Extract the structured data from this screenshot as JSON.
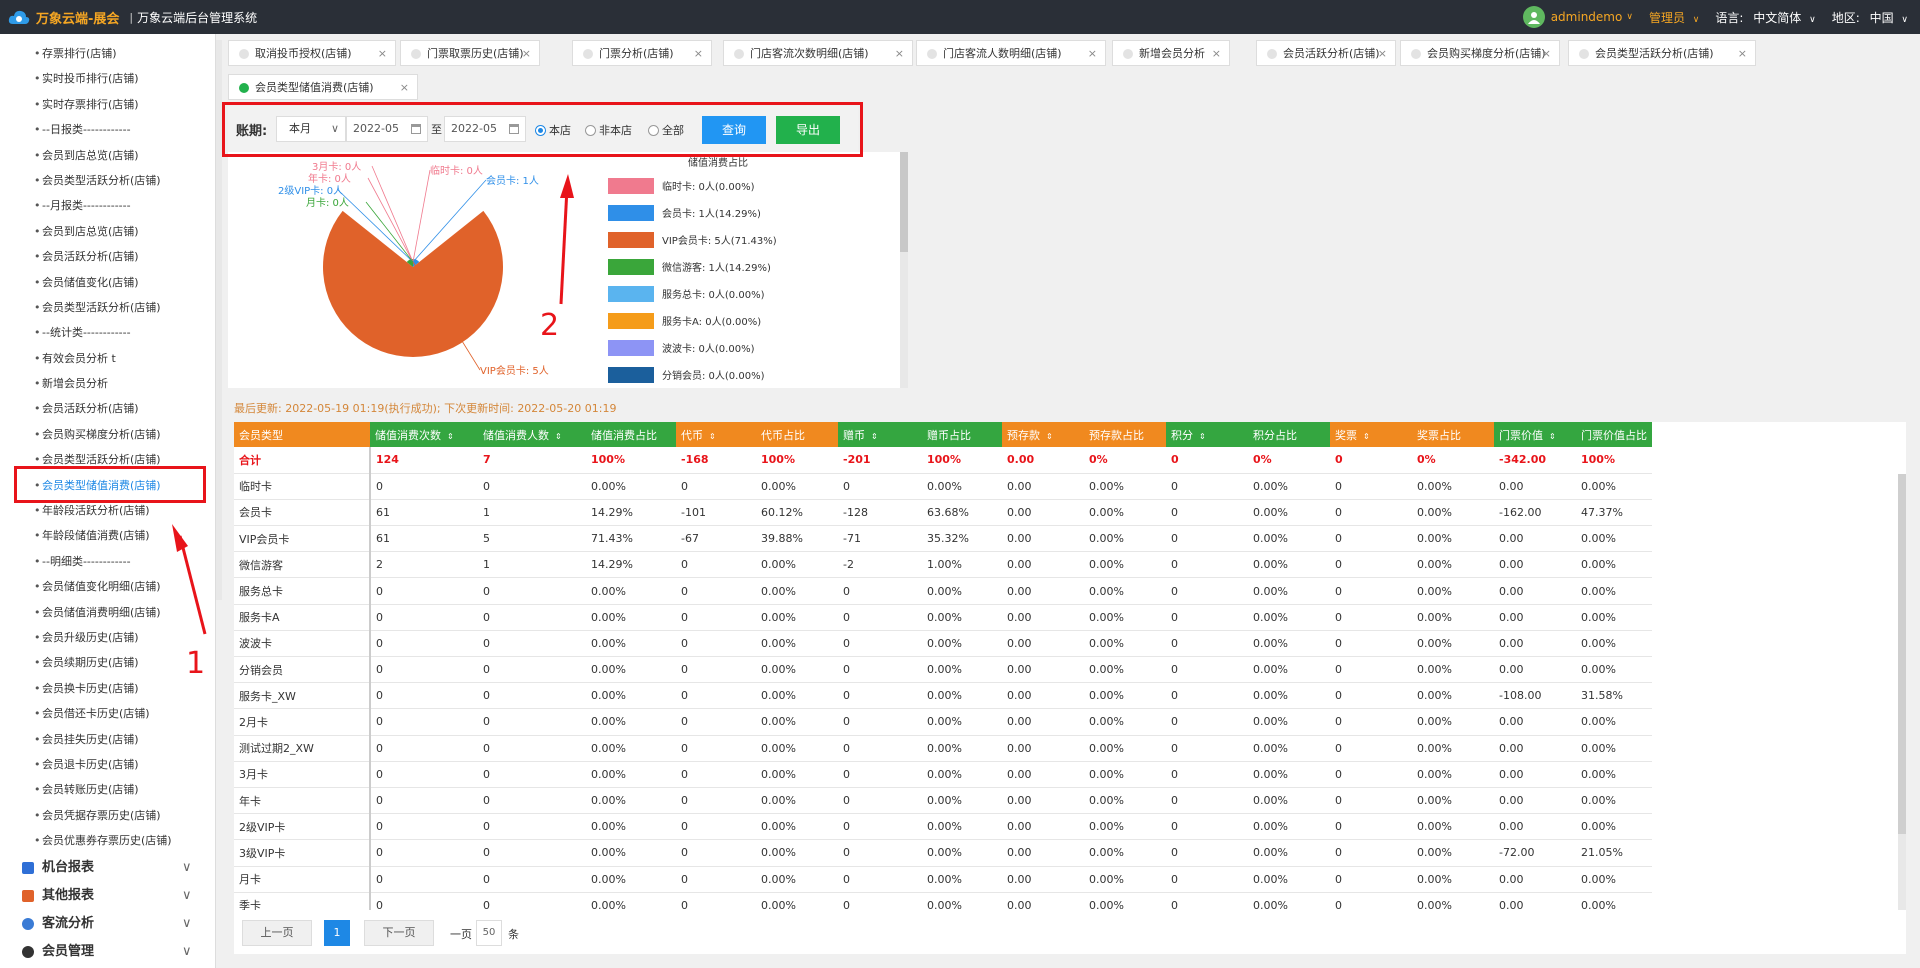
{
  "header": {
    "brand": "万象云端-展会",
    "separator": "|",
    "system_title": "万象云端后台管理系统",
    "username": "admindemo",
    "role": "管理员",
    "language_label": "语言:",
    "language_value": "中文简体",
    "region_label": "地区:",
    "region_value": "中国"
  },
  "sidebar": {
    "items": [
      "存票排行(店铺)",
      "实时投币排行(店铺)",
      "实时存票排行(店铺)",
      "--日报类------------",
      "会员到店总览(店铺)",
      "会员类型活跃分析(店铺)",
      "--月报类------------",
      "会员到店总览(店铺)",
      "会员活跃分析(店铺)",
      "会员储值变化(店铺)",
      "会员类型活跃分析(店铺)",
      "--统计类------------",
      "有效会员分析 t",
      "新增会员分析",
      "会员活跃分析(店铺)",
      "会员购买梯度分析(店铺)",
      "会员类型活跃分析(店铺)",
      "会员类型储值消费(店铺)",
      "年龄段活跃分析(店铺)",
      "年龄段储值消费(店铺)",
      "--明细类------------",
      "会员储值变化明细(店铺)",
      "会员储值消费明细(店铺)",
      "会员升级历史(店铺)",
      "会员续期历史(店铺)",
      "会员换卡历史(店铺)",
      "会员借还卡历史(店铺)",
      "会员挂失历史(店铺)",
      "会员退卡历史(店铺)",
      "会员转账历史(店铺)",
      "会员凭据存票历史(店铺)",
      "会员优惠券存票历史(店铺)"
    ],
    "active_index": 17,
    "groups": [
      "机台报表",
      "其他报表",
      "客流分析",
      "会员管理"
    ]
  },
  "tabs": [
    "取消投币授权(店铺)",
    "门票取票历史(店铺)",
    "门票分析(店铺)",
    "门店客流次数明细(店铺)",
    "门店客流人数明细(店铺)",
    "新增会员分析",
    "会员活跃分析(店铺)",
    "会员购买梯度分析(店铺)",
    "会员类型活跃分析(店铺)",
    "会员类型储值消费(店铺)"
  ],
  "toolbar": {
    "period_label": "账期:",
    "period_select": "本月",
    "date_from": "2022-05",
    "to_label": "至",
    "date_to": "2022-05",
    "radio_this_store": "本店",
    "radio_other_store": "非本店",
    "radio_all": "全部",
    "query_label": "查询",
    "export_label": "导出"
  },
  "chart_data": {
    "type": "pie",
    "title": "储值消费占比",
    "slices": [
      {
        "label": "临时卡",
        "text": "临时卡: 0人(0.00%)",
        "value": 0,
        "color": "#f07a8e"
      },
      {
        "label": "会员卡",
        "text": "会员卡: 1人(14.29%)",
        "value": 1,
        "color": "#2f8fe8"
      },
      {
        "label": "VIP会员卡",
        "text": "VIP会员卡: 5人(71.43%)",
        "value": 5,
        "color": "#e0622a"
      },
      {
        "label": "微信游客",
        "text": "微信游客: 1人(14.29%)",
        "value": 1,
        "color": "#3aa63a"
      },
      {
        "label": "服务总卡",
        "text": "服务总卡: 0人(0.00%)",
        "value": 0,
        "color": "#5ab4ef"
      },
      {
        "label": "服务卡A",
        "text": "服务卡A: 0人(0.00%)",
        "value": 0,
        "color": "#f59c1a"
      },
      {
        "label": "波波卡",
        "text": "波波卡: 0人(0.00%)",
        "value": 0,
        "color": "#8d94f5"
      },
      {
        "label": "分销会员",
        "text": "分销会员: 0人(0.00%)",
        "value": 0,
        "color": "#1b5f9c"
      }
    ],
    "callouts": [
      "临时卡: 0人",
      "会员卡: 1人",
      "VIP会员卡: 5人",
      "3月卡: 0人",
      "年卡: 0人",
      "2级VIP卡: 0人",
      "月卡: 0人"
    ],
    "legend_position": "right"
  },
  "update_info": "最后更新: 2022-05-19 01:19(执行成功); 下次更新时间: 2022-05-20 01:19",
  "table": {
    "columns": [
      "会员类型",
      "储值消费次数",
      "储值消费人数",
      "储值消费占比",
      "代币",
      "代币占比",
      "赠币",
      "赠币占比",
      "预存款",
      "预存款占比",
      "积分",
      "积分占比",
      "奖票",
      "奖票占比",
      "门票价值",
      "门票价值占比"
    ],
    "sortable": [
      false,
      true,
      true,
      false,
      true,
      false,
      true,
      false,
      true,
      false,
      true,
      false,
      true,
      false,
      true,
      false
    ],
    "header_colors": [
      "o",
      "g",
      "g",
      "g",
      "o",
      "o",
      "g",
      "g",
      "o",
      "o",
      "g",
      "g",
      "o",
      "o",
      "g",
      "g"
    ],
    "total": [
      "合计",
      "124",
      "7",
      "100%",
      "-168",
      "100%",
      "-201",
      "100%",
      "0.00",
      "0%",
      "0",
      "0%",
      "0",
      "0%",
      "-342.00",
      "100%"
    ],
    "rows": [
      [
        "临时卡",
        "0",
        "0",
        "0.00%",
        "0",
        "0.00%",
        "0",
        "0.00%",
        "0.00",
        "0.00%",
        "0",
        "0.00%",
        "0",
        "0.00%",
        "0.00",
        "0.00%"
      ],
      [
        "会员卡",
        "61",
        "1",
        "14.29%",
        "-101",
        "60.12%",
        "-128",
        "63.68%",
        "0.00",
        "0.00%",
        "0",
        "0.00%",
        "0",
        "0.00%",
        "-162.00",
        "47.37%"
      ],
      [
        "VIP会员卡",
        "61",
        "5",
        "71.43%",
        "-67",
        "39.88%",
        "-71",
        "35.32%",
        "0.00",
        "0.00%",
        "0",
        "0.00%",
        "0",
        "0.00%",
        "0.00",
        "0.00%"
      ],
      [
        "微信游客",
        "2",
        "1",
        "14.29%",
        "0",
        "0.00%",
        "-2",
        "1.00%",
        "0.00",
        "0.00%",
        "0",
        "0.00%",
        "0",
        "0.00%",
        "0.00",
        "0.00%"
      ],
      [
        "服务总卡",
        "0",
        "0",
        "0.00%",
        "0",
        "0.00%",
        "0",
        "0.00%",
        "0.00",
        "0.00%",
        "0",
        "0.00%",
        "0",
        "0.00%",
        "0.00",
        "0.00%"
      ],
      [
        "服务卡A",
        "0",
        "0",
        "0.00%",
        "0",
        "0.00%",
        "0",
        "0.00%",
        "0.00",
        "0.00%",
        "0",
        "0.00%",
        "0",
        "0.00%",
        "0.00",
        "0.00%"
      ],
      [
        "波波卡",
        "0",
        "0",
        "0.00%",
        "0",
        "0.00%",
        "0",
        "0.00%",
        "0.00",
        "0.00%",
        "0",
        "0.00%",
        "0",
        "0.00%",
        "0.00",
        "0.00%"
      ],
      [
        "分销会员",
        "0",
        "0",
        "0.00%",
        "0",
        "0.00%",
        "0",
        "0.00%",
        "0.00",
        "0.00%",
        "0",
        "0.00%",
        "0",
        "0.00%",
        "0.00",
        "0.00%"
      ],
      [
        "服务卡_XW",
        "0",
        "0",
        "0.00%",
        "0",
        "0.00%",
        "0",
        "0.00%",
        "0.00",
        "0.00%",
        "0",
        "0.00%",
        "0",
        "0.00%",
        "-108.00",
        "31.58%"
      ],
      [
        "2月卡",
        "0",
        "0",
        "0.00%",
        "0",
        "0.00%",
        "0",
        "0.00%",
        "0.00",
        "0.00%",
        "0",
        "0.00%",
        "0",
        "0.00%",
        "0.00",
        "0.00%"
      ],
      [
        "测试过期2_XW",
        "0",
        "0",
        "0.00%",
        "0",
        "0.00%",
        "0",
        "0.00%",
        "0.00",
        "0.00%",
        "0",
        "0.00%",
        "0",
        "0.00%",
        "0.00",
        "0.00%"
      ],
      [
        "3月卡",
        "0",
        "0",
        "0.00%",
        "0",
        "0.00%",
        "0",
        "0.00%",
        "0.00",
        "0.00%",
        "0",
        "0.00%",
        "0",
        "0.00%",
        "0.00",
        "0.00%"
      ],
      [
        "年卡",
        "0",
        "0",
        "0.00%",
        "0",
        "0.00%",
        "0",
        "0.00%",
        "0.00",
        "0.00%",
        "0",
        "0.00%",
        "0",
        "0.00%",
        "0.00",
        "0.00%"
      ],
      [
        "2级VIP卡",
        "0",
        "0",
        "0.00%",
        "0",
        "0.00%",
        "0",
        "0.00%",
        "0.00",
        "0.00%",
        "0",
        "0.00%",
        "0",
        "0.00%",
        "0.00",
        "0.00%"
      ],
      [
        "3级VIP卡",
        "0",
        "0",
        "0.00%",
        "0",
        "0.00%",
        "0",
        "0.00%",
        "0.00",
        "0.00%",
        "0",
        "0.00%",
        "0",
        "0.00%",
        "-72.00",
        "21.05%"
      ],
      [
        "月卡",
        "0",
        "0",
        "0.00%",
        "0",
        "0.00%",
        "0",
        "0.00%",
        "0.00",
        "0.00%",
        "0",
        "0.00%",
        "0",
        "0.00%",
        "0.00",
        "0.00%"
      ],
      [
        "季卡",
        "0",
        "0",
        "0.00%",
        "0",
        "0.00%",
        "0",
        "0.00%",
        "0.00",
        "0.00%",
        "0",
        "0.00%",
        "0",
        "0.00%",
        "0.00",
        "0.00%"
      ]
    ]
  },
  "pager": {
    "prev": "上一页",
    "current": "1",
    "next": "下一页",
    "per_page_label": "一页",
    "per_page_value": "50",
    "unit": "条"
  },
  "annotations": {
    "marker_1": "1",
    "marker_2": "2",
    "color": "#e8141a"
  }
}
